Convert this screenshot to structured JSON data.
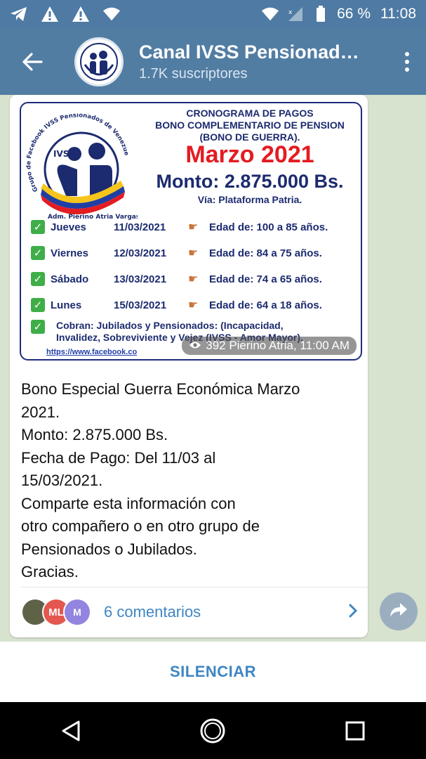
{
  "status_bar": {
    "battery": "66 %",
    "time": "11:08",
    "icons": [
      "telegram-icon",
      "warning-icon",
      "warning-icon",
      "wifi-icon",
      "wifi-icon",
      "signal-icon",
      "battery-icon"
    ]
  },
  "header": {
    "title": "Canal IVSS Pensionad…",
    "subscribers": "1.7K suscriptores"
  },
  "poster": {
    "logo_text": "IVSS",
    "logo_arc_text": "Grupo de Facebook IVSS Pensionados de Venezuela",
    "logo_admin": "Adm. Pierino Atria Vargas",
    "heading_1": "CRONOGRAMA DE PAGOS",
    "heading_2": "BONO COMPLEMENTARIO DE PENSION",
    "heading_3": "(BONO DE GUERRA).",
    "month": "Marzo 2021",
    "monto": "Monto: 2.875.000 Bs.",
    "via": "Vía: Plataforma Patria.",
    "schedule": [
      {
        "day": "Jueves",
        "date": "11/03/2021",
        "edad": "Edad de: 100 a 85 años."
      },
      {
        "day": "Viernes",
        "date": "12/03/2021",
        "edad": "Edad de:  84 a 75 años."
      },
      {
        "day": "Sábado",
        "date": "13/03/2021",
        "edad": "Edad de:  74 a 65 años."
      },
      {
        "day": "Lunes",
        "date": "15/03/2021",
        "edad": "Edad de:  64 a 18 años."
      }
    ],
    "cobran_line1": "Cobran: Jubilados y Pensionados: (Incapacidad,",
    "cobran_line2": "Invalidez, Sobreviviente y Vejez (IVSS - Amor Mayor).",
    "link": "https://www.facebook.co",
    "views": "392 Pierino Atria, 11:00 AM"
  },
  "message": {
    "lines": [
      "Bono Especial Guerra Económica Marzo",
      "2021.",
      "Monto: 2.875.000 Bs.",
      "Fecha de Pago: Del 11/03 al",
      "15/03/2021.",
      "Comparte esta información con",
      "otro compañero o en otro grupo de",
      "Pensionados o Jubilados.",
      "Gracias."
    ]
  },
  "comments": {
    "avatars": [
      "",
      "ML",
      "M"
    ],
    "label": "6 comentarios"
  },
  "footer": {
    "mute_label": "SILENCIAR"
  }
}
